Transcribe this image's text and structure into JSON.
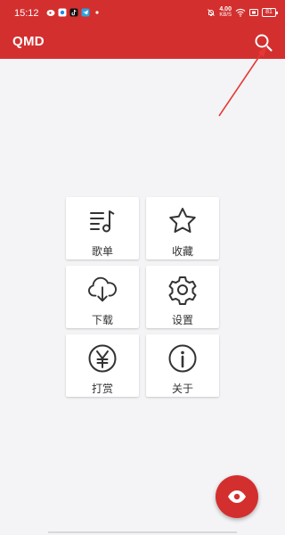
{
  "status_bar": {
    "time": "15:12",
    "net_speed_value": "4.00",
    "net_speed_unit": "KB/S",
    "battery_level": "81",
    "notification_icons": [
      "weibo-icon",
      "camera-app-icon",
      "tiktok-icon",
      "telegram-icon",
      "dot-icon"
    ],
    "status_icons": [
      "mute-bell-icon",
      "network-speed",
      "wifi-icon",
      "volte-icon",
      "battery-icon"
    ]
  },
  "app_bar": {
    "title": "QMD",
    "search_icon": "search-icon"
  },
  "menu": {
    "items": [
      {
        "label": "歌单",
        "icon": "playlist-icon"
      },
      {
        "label": "收藏",
        "icon": "star-icon"
      },
      {
        "label": "下载",
        "icon": "cloud-download-icon"
      },
      {
        "label": "设置",
        "icon": "gear-icon"
      },
      {
        "label": "打赏",
        "icon": "yen-icon"
      },
      {
        "label": "关于",
        "icon": "info-icon"
      }
    ]
  },
  "fab": {
    "icon": "eye-icon"
  },
  "colors": {
    "primary": "#d32f2f",
    "background": "#f4f4f6",
    "tile": "#ffffff",
    "icon": "#333333",
    "annotation_arrow": "#e53935"
  }
}
